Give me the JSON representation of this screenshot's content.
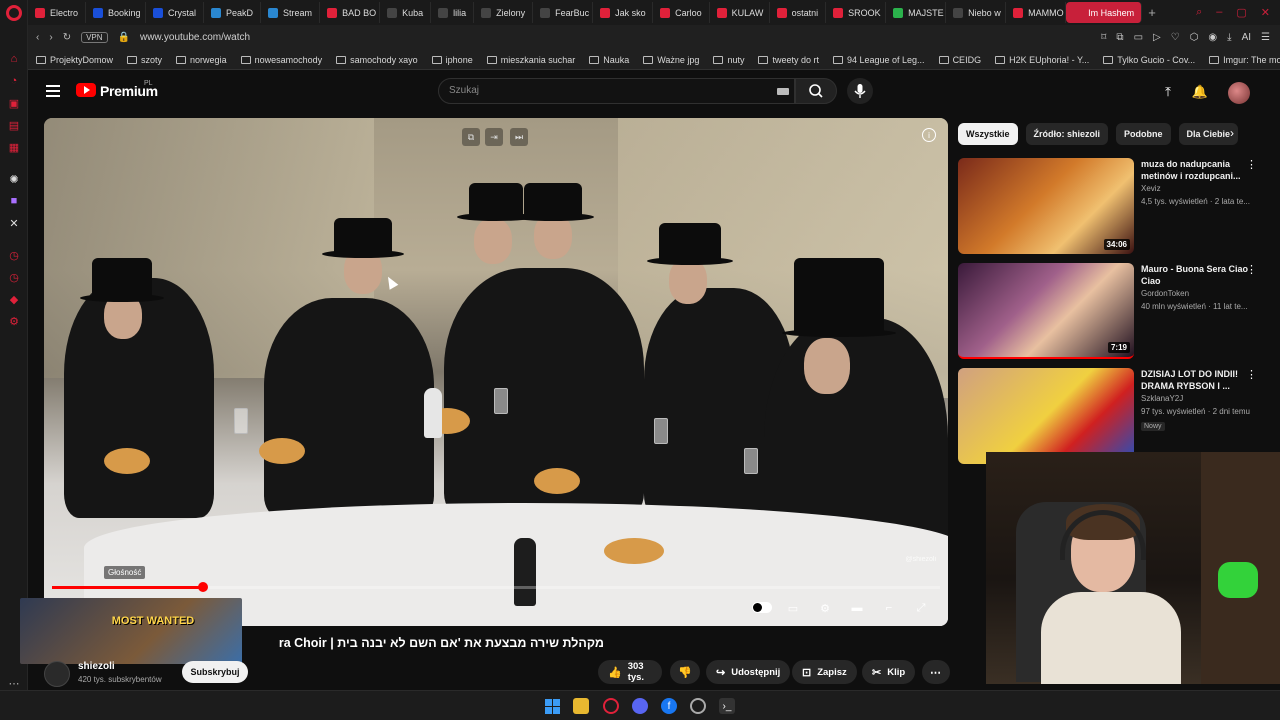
{
  "browser": {
    "tabs": [
      {
        "label": "Electro",
        "color": "#e0213a"
      },
      {
        "label": "Booking",
        "color": "#1a4fd8"
      },
      {
        "label": "Crystal",
        "color": "#1a4fd8"
      },
      {
        "label": "PeakD",
        "color": "#2a87d0"
      },
      {
        "label": "Stream",
        "color": "#2a87d0"
      },
      {
        "label": "BAD BO",
        "color": "#e0213a"
      },
      {
        "label": "Kuba",
        "color": "#444"
      },
      {
        "label": "lilia",
        "color": "#444"
      },
      {
        "label": "Zielony",
        "color": "#444"
      },
      {
        "label": "FearBuc",
        "color": "#444"
      },
      {
        "label": "Jak sko",
        "color": "#e0213a"
      },
      {
        "label": "Carloo",
        "color": "#e0213a"
      },
      {
        "label": "KULAW",
        "color": "#e0213a"
      },
      {
        "label": "ostatni",
        "color": "#e0213a"
      },
      {
        "label": "SROOK",
        "color": "#e0213a"
      },
      {
        "label": "MAJSTE",
        "color": "#2bb24c"
      },
      {
        "label": "Niebo w",
        "color": "#444"
      },
      {
        "label": "MAMMO",
        "color": "#e0213a"
      },
      {
        "label": "Im Hashem",
        "color": "#ffffff",
        "active": true
      }
    ],
    "new_tab": "+",
    "url": "www.youtube.com/watch",
    "vpn_label": "VPN",
    "ai_label": "AI",
    "bookmarks": [
      "ProjektyDomow",
      "szoty",
      "norwegia",
      "nowesamochody",
      "samochody xayo",
      "iphone",
      "mieszkania suchar",
      "Nauka",
      "Ważne jpg",
      "nuty",
      "tweety do rt",
      "94 League of Leg...",
      "CEIDG",
      "H2K EUphoria! - Y...",
      "Tylko Gucio - Cov...",
      "Imgur: The most a..."
    ]
  },
  "youtube": {
    "brand": "Premium",
    "brand_sup": "PL",
    "search_placeholder": "Szukaj",
    "accent": "#ff0000"
  },
  "player": {
    "volume_tooltip": "Głośność",
    "watermark": "@shiezoli",
    "progress": 0.17
  },
  "video": {
    "title": "מקהלת שירה מבצעת את 'אם השם לא יבנה בית | ra Choir",
    "channel": "shiezoli",
    "subscribers": "420 tys. subskrybentów",
    "subscribe_label": "Subskrybuj",
    "likes": "303 tys.",
    "share_label": "Udostępnij",
    "save_label": "Zapisz",
    "clip_label": "Klip"
  },
  "ad": {
    "text": "MOST WANTED"
  },
  "chips": [
    "Wszystkie",
    "Źródło: shiezoli",
    "Podobne",
    "Dla Ciebie"
  ],
  "recommendations": [
    {
      "title": "muza do nadupcania metinów i rozdupcani...",
      "channel": "Xeviz",
      "meta": "4,5 tys. wyświetleń · 2 lata te...",
      "duration": "34:06",
      "badge": ""
    },
    {
      "title": "Mauro - Buona Sera Ciao Ciao",
      "channel": "GordonToken",
      "meta": "40 mln wyświetleń · 11 lat te...",
      "duration": "7:19",
      "badge": ""
    },
    {
      "title": "DZISIAJ LOT DO INDII! DRAMA RYBSON I ...",
      "channel": "SzklanaY2J",
      "meta": "97 tys. wyświetleń · 2 dni temu",
      "duration": "",
      "badge": "Nowy"
    }
  ]
}
